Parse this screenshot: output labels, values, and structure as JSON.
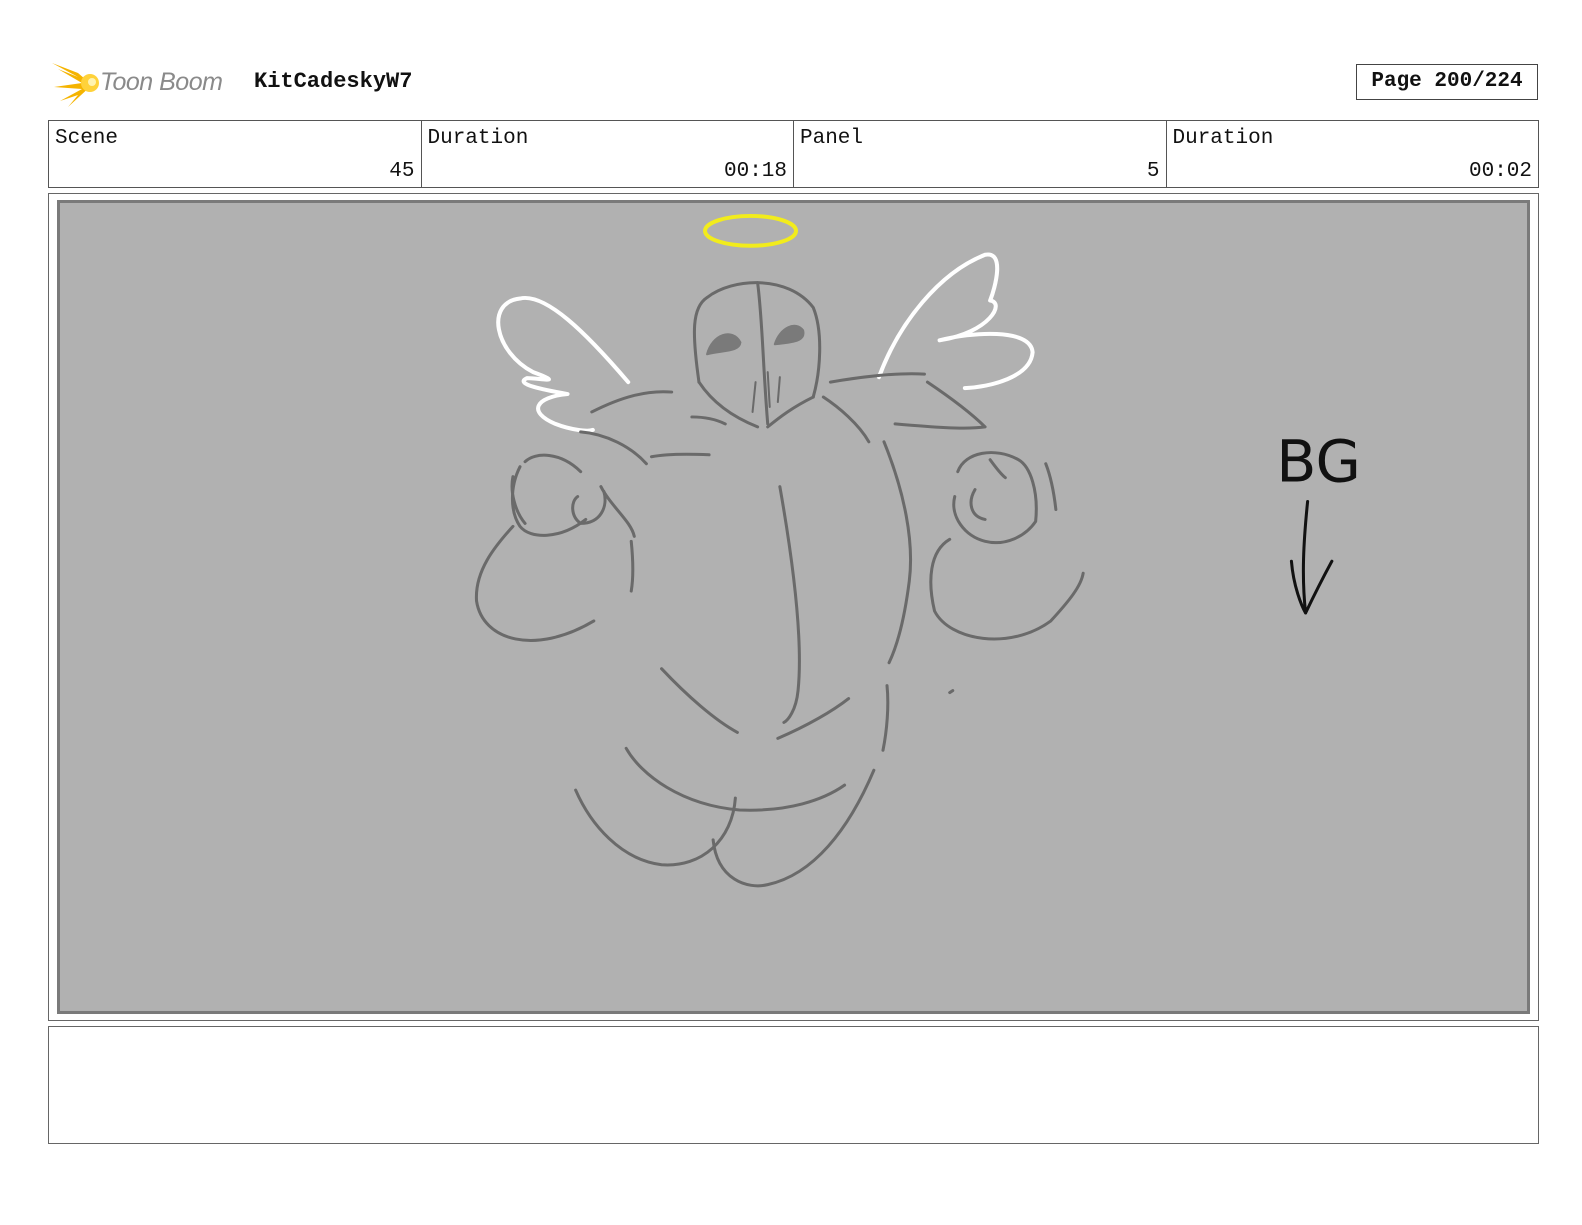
{
  "header": {
    "logo_text": "Toon Boom",
    "project_name": "KitCadeskyW7",
    "page_label": "Page 200/224"
  },
  "info": {
    "scene_label": "Scene",
    "scene_value": "45",
    "scene_duration_label": "Duration",
    "scene_duration_value": "00:18",
    "panel_label": "Panel",
    "panel_value": "5",
    "panel_duration_label": "Duration",
    "panel_duration_value": "00:02"
  },
  "sketch": {
    "note_text": "BG"
  },
  "colors": {
    "panel_bg": "#b1b1b1",
    "sketch_gray": "#6a6a6a",
    "halo": "#f2ec1c",
    "wings": "#ffffff",
    "logo_accent": "#f5b400"
  }
}
